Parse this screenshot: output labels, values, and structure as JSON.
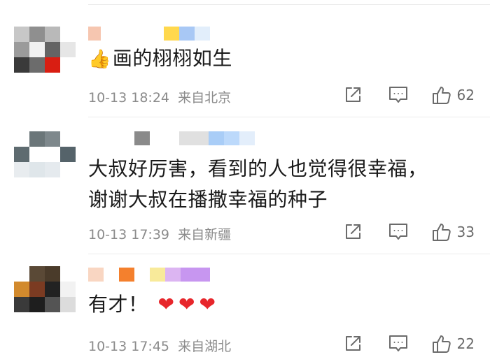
{
  "comments": [
    {
      "text": "画的栩栩如生",
      "emoji": "👍",
      "time": "10-13 18:24",
      "location": "来自北京",
      "likes": "62",
      "avatar_pixels": [
        "#c7c7c7",
        "#8f8f8f",
        "#b9b9b9",
        "#ffffff",
        "#9b9b9b",
        "#f1f1f1",
        "#646464",
        "#e6e6e6",
        "#3a3a3a",
        "#6c6c6c",
        "#d91e12",
        "#ffffff"
      ],
      "name_blocks": [
        "#f6c6b0",
        "#ffffff",
        "#ffffff",
        "#ffffff",
        "#ffd84d",
        "#a8c8f5",
        "#e2eefb"
      ]
    },
    {
      "text_line1": "大叔好厉害，看到的人也觉得很幸福，",
      "text_line2": "谢谢大叔在播撒幸福的种子",
      "time": "10-13 17:39",
      "location": "来自新疆",
      "likes": "33",
      "avatar_pixels": [
        "#ffffff",
        "#6b7679",
        "#7e888c",
        "#ffffff",
        "#5e6b70",
        "#ffffff",
        "#ffffff",
        "#55636a",
        "#e8ecef",
        "#dfe6ea",
        "#e5eaee",
        "#ffffff"
      ],
      "name_blocks": [
        "#ffffff",
        "#8a8a8a",
        "#ffffff",
        "#e0e0e0",
        "#a9cdf7",
        "#bcd9fb",
        "#e3eefb"
      ]
    },
    {
      "text": "有才！",
      "hearts": "❤❤❤",
      "time": "10-13 17:45",
      "location": "来自湖北",
      "likes": "22",
      "avatar_pixels": [
        "#ffffff",
        "#5a4936",
        "#4a3b2a",
        "#ffffff",
        "#d28a2d",
        "#7b3b22",
        "#222222",
        "#f2f2f2",
        "#3a3a3a",
        "#1e1e1e",
        "#545454",
        "#dcdcdc"
      ],
      "name_blocks": [
        "#f9d6c2",
        "#ffffff",
        "#f4802d",
        "#ffffff",
        "#f8ea9a",
        "#dcb5f2",
        "#c796f0"
      ]
    }
  ]
}
